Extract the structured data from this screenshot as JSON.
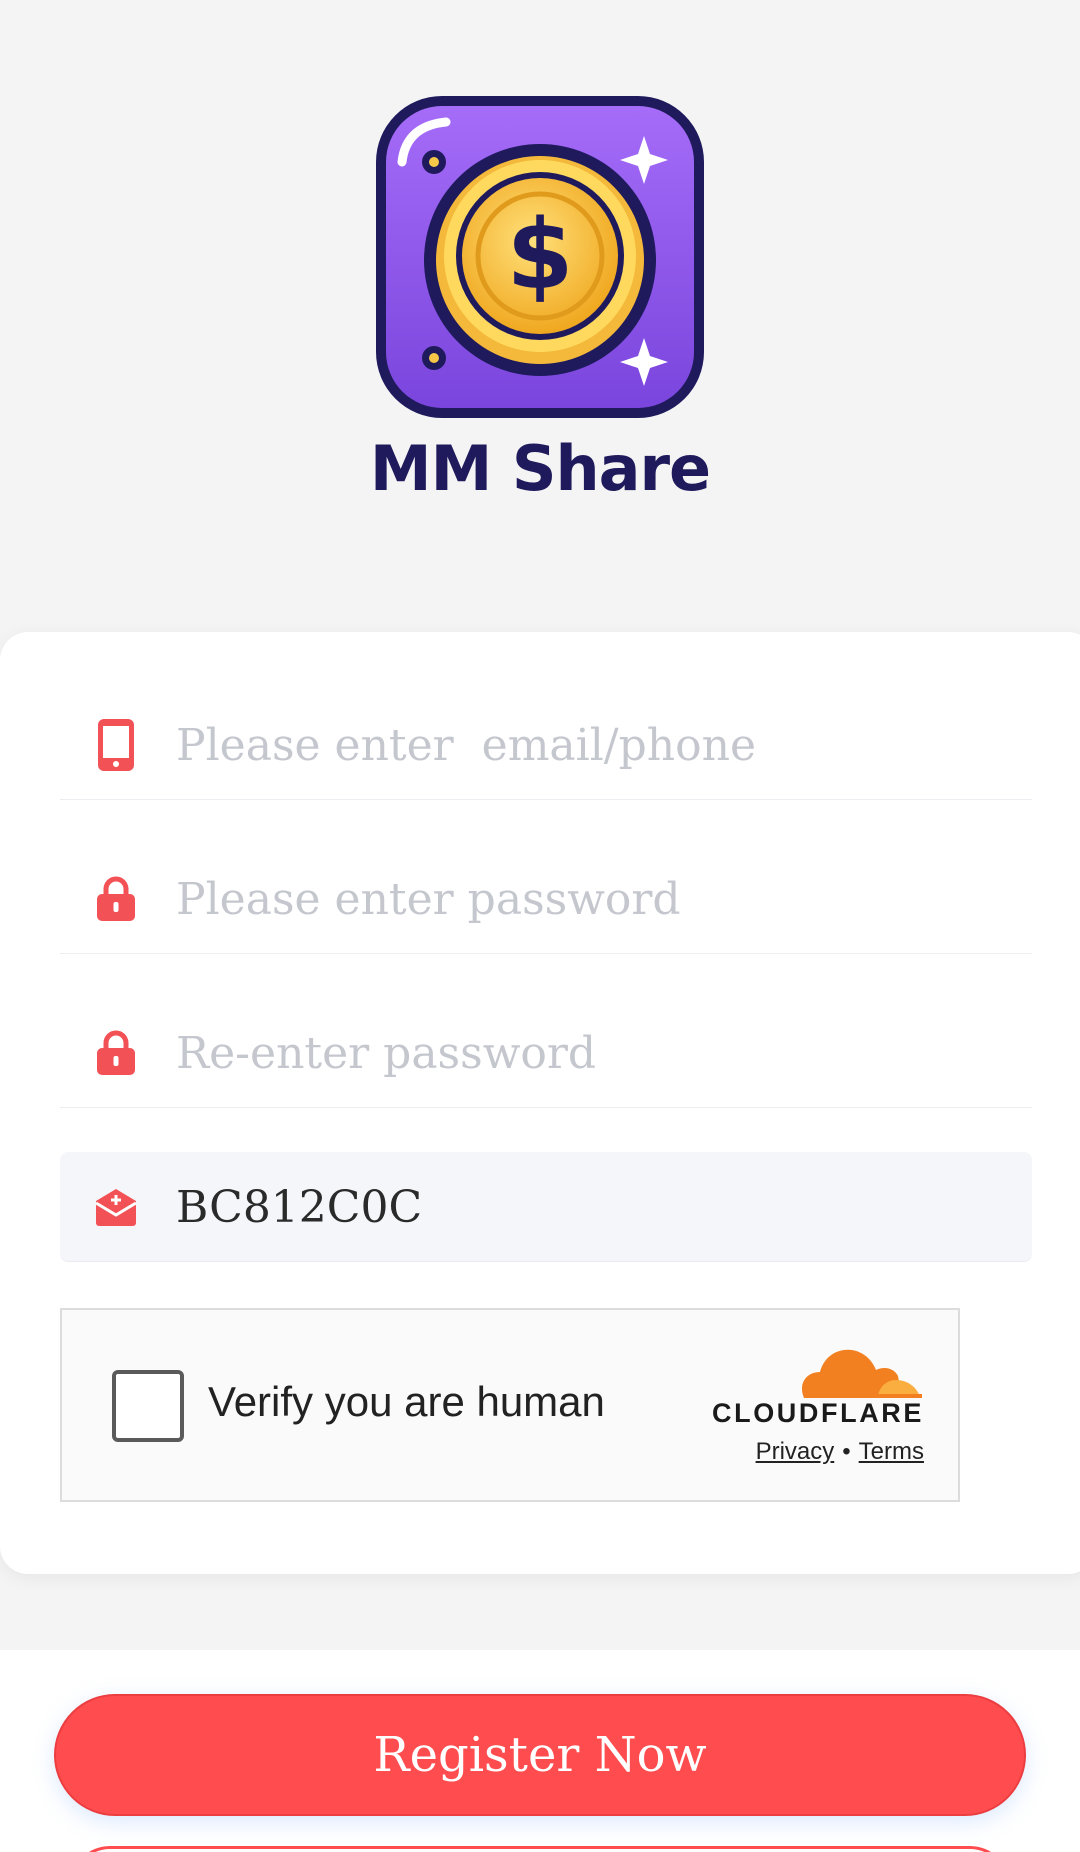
{
  "app": {
    "brand_name": "MM Share",
    "logo_icon": "coin-dollar-icon",
    "accent_color": "#ff4c4f",
    "brand_color": "#1f1a5c",
    "icon_bg_color": "#8f57ee"
  },
  "form": {
    "account": {
      "placeholder": "Please enter  email/phone",
      "value": "",
      "icon": "phone-icon"
    },
    "password": {
      "placeholder": "Please enter password",
      "value": "",
      "icon": "lock-icon"
    },
    "confirm_password": {
      "placeholder": "Re-enter password",
      "value": "",
      "icon": "lock-icon"
    },
    "invite_code": {
      "placeholder": "",
      "value": "BC812C0C",
      "icon": "envelope-icon"
    }
  },
  "captcha": {
    "label": "Verify you are human",
    "provider": "CLOUDFLARE",
    "privacy_link": "Privacy",
    "separator": "•",
    "terms_link": "Terms",
    "checked": false
  },
  "actions": {
    "register_label": "Register Now"
  }
}
